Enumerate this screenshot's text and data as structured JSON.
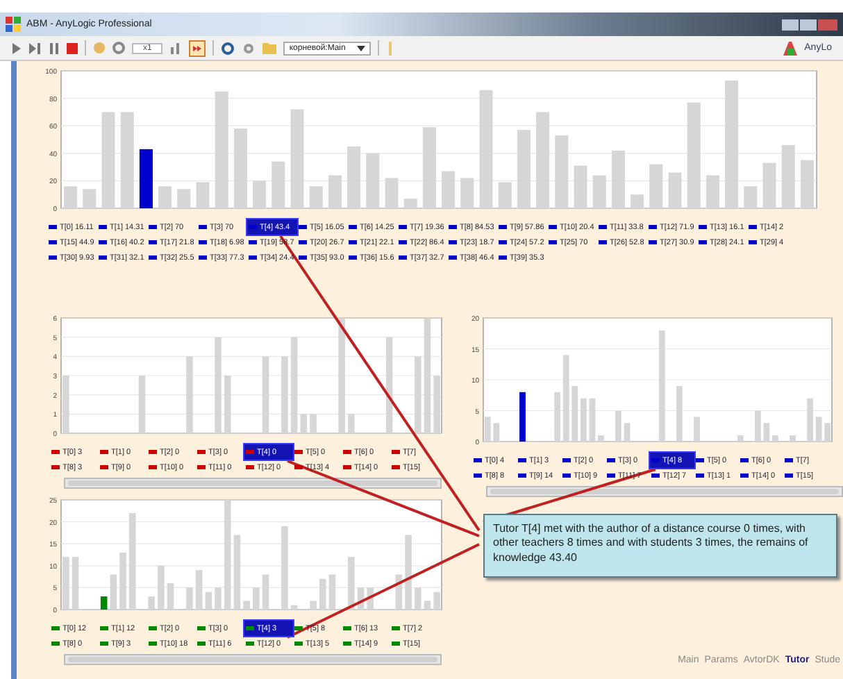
{
  "window": {
    "title": "ABM - AnyLogic Professional"
  },
  "toolbar": {
    "speed": "x1",
    "experiment": "корневой:Main",
    "brand": "AnyLo"
  },
  "charts": [
    {
      "color": "#0000cc",
      "chart_data": {
        "type": "bar",
        "grid": true,
        "values": [
          16,
          14,
          70,
          70,
          43,
          16,
          14,
          19,
          85,
          58,
          20,
          34,
          72,
          16,
          24,
          45,
          40,
          22,
          7,
          59,
          27,
          22,
          86,
          19,
          57,
          70,
          53,
          31,
          24,
          42,
          10,
          32,
          26,
          77,
          24,
          93,
          16,
          33,
          46,
          35
        ],
        "ylim": [
          0,
          100
        ],
        "yticks": [
          0,
          20,
          40,
          60,
          80,
          100
        ]
      },
      "legend": [
        {
          "label": "T[0] 16.11",
          "selected": false
        },
        {
          "label": "T[1] 14.31",
          "selected": false
        },
        {
          "label": "T[2] 70",
          "selected": false
        },
        {
          "label": "T[3] 70",
          "selected": false
        },
        {
          "label": "T[4] 43.4",
          "selected": true
        },
        {
          "label": "T[5] 16.05",
          "selected": false
        },
        {
          "label": "T[6] 14.25",
          "selected": false
        },
        {
          "label": "T[7] 19.36",
          "selected": false
        },
        {
          "label": "T[8] 84.53",
          "selected": false
        },
        {
          "label": "T[9] 57.86",
          "selected": false
        },
        {
          "label": "T[10] 20.4",
          "selected": false
        },
        {
          "label": "T[11] 33.8",
          "selected": false
        },
        {
          "label": "T[12] 71.9",
          "selected": false
        },
        {
          "label": "T[13] 16.1",
          "selected": false
        },
        {
          "label": "T[14] 2",
          "selected": false
        },
        {
          "label": "T[15] 44.9",
          "selected": false
        },
        {
          "label": "T[16] 40.2",
          "selected": false
        },
        {
          "label": "T[17] 21.8",
          "selected": false
        },
        {
          "label": "T[18] 6.98",
          "selected": false
        },
        {
          "label": "T[19] 58.7",
          "selected": false
        },
        {
          "label": "T[20] 26.7",
          "selected": false
        },
        {
          "label": "T[21] 22.1",
          "selected": false
        },
        {
          "label": "T[22] 86.4",
          "selected": false
        },
        {
          "label": "T[23] 18.7",
          "selected": false
        },
        {
          "label": "T[24] 57.2",
          "selected": false
        },
        {
          "label": "T[25] 70",
          "selected": false
        },
        {
          "label": "T[26] 52.8",
          "selected": false
        },
        {
          "label": "T[27] 30.9",
          "selected": false
        },
        {
          "label": "T[28] 24.1",
          "selected": false
        },
        {
          "label": "T[29] 4",
          "selected": false
        },
        {
          "label": "T[30] 9.93",
          "selected": false
        },
        {
          "label": "T[31] 32.1",
          "selected": false
        },
        {
          "label": "T[32] 25.5",
          "selected": false
        },
        {
          "label": "T[33] 77.3",
          "selected": false
        },
        {
          "label": "T[34] 24.4",
          "selected": false
        },
        {
          "label": "T[35] 93.0",
          "selected": false
        },
        {
          "label": "T[36] 15.6",
          "selected": false
        },
        {
          "label": "T[37] 32.7",
          "selected": false
        },
        {
          "label": "T[38] 46.4",
          "selected": false
        },
        {
          "label": "T[39] 35.3",
          "selected": false
        }
      ]
    },
    {
      "color": "#cc0000",
      "chart_data": {
        "type": "bar",
        "grid": true,
        "values": [
          3,
          0,
          0,
          0,
          0,
          0,
          0,
          0,
          3,
          0,
          0,
          0,
          0,
          4,
          0,
          0,
          5,
          3,
          0,
          0,
          0,
          4,
          0,
          4,
          5,
          1,
          1,
          0,
          0,
          6,
          1,
          0,
          0,
          0,
          5,
          0,
          0,
          4,
          6,
          3
        ],
        "ylim": [
          0,
          6
        ],
        "yticks": [
          0,
          1,
          2,
          3,
          4,
          5,
          6
        ]
      },
      "legend": [
        {
          "label": "T[0] 3",
          "selected": false
        },
        {
          "label": "T[1] 0",
          "selected": false
        },
        {
          "label": "T[2] 0",
          "selected": false
        },
        {
          "label": "T[3] 0",
          "selected": false
        },
        {
          "label": "T[4] 0",
          "selected": true
        },
        {
          "label": "T[5] 0",
          "selected": false
        },
        {
          "label": "T[6] 0",
          "selected": false
        },
        {
          "label": "T[7]",
          "selected": false
        },
        {
          "label": "T[8] 3",
          "selected": false
        },
        {
          "label": "T[9] 0",
          "selected": false
        },
        {
          "label": "T[10] 0",
          "selected": false
        },
        {
          "label": "T[11] 0",
          "selected": false
        },
        {
          "label": "T[12] 0",
          "selected": false
        },
        {
          "label": "T[13] 4",
          "selected": false
        },
        {
          "label": "T[14] 0",
          "selected": false
        },
        {
          "label": "T[15]",
          "selected": false
        }
      ]
    },
    {
      "color": "#0000cc",
      "chart_data": {
        "type": "bar",
        "grid": true,
        "values": [
          4,
          3,
          0,
          0,
          8,
          0,
          0,
          0,
          8,
          14,
          9,
          7,
          7,
          1,
          0,
          5,
          3,
          0,
          0,
          0,
          18,
          0,
          9,
          0,
          4,
          0,
          0,
          0,
          0,
          1,
          0,
          5,
          3,
          1,
          0,
          1,
          0,
          7,
          4,
          3
        ],
        "ylim": [
          0,
          20
        ],
        "yticks": [
          0,
          5,
          10,
          15,
          20
        ]
      },
      "legend": [
        {
          "label": "T[0] 4",
          "selected": false
        },
        {
          "label": "T[1] 3",
          "selected": false
        },
        {
          "label": "T[2] 0",
          "selected": false
        },
        {
          "label": "T[3] 0",
          "selected": false
        },
        {
          "label": "T[4] 8",
          "selected": true
        },
        {
          "label": "T[5] 0",
          "selected": false
        },
        {
          "label": "T[6] 0",
          "selected": false
        },
        {
          "label": "T[7]",
          "selected": false
        },
        {
          "label": "T[8] 8",
          "selected": false
        },
        {
          "label": "T[9] 14",
          "selected": false
        },
        {
          "label": "T[10] 9",
          "selected": false
        },
        {
          "label": "T[11] 7",
          "selected": false
        },
        {
          "label": "T[12] 7",
          "selected": false
        },
        {
          "label": "T[13] 1",
          "selected": false
        },
        {
          "label": "T[14] 0",
          "selected": false
        },
        {
          "label": "T[15]",
          "selected": false
        }
      ]
    },
    {
      "color": "#008800",
      "chart_data": {
        "type": "bar",
        "grid": true,
        "values": [
          12,
          12,
          0,
          0,
          3,
          8,
          13,
          22,
          0,
          3,
          10,
          6,
          0,
          5,
          9,
          4,
          5,
          25,
          17,
          2,
          5,
          8,
          0,
          19,
          1,
          0,
          2,
          7,
          8,
          0,
          12,
          5,
          5,
          0,
          0,
          8,
          17,
          5,
          2,
          4
        ],
        "ylim": [
          0,
          25
        ],
        "yticks": [
          0,
          5,
          10,
          15,
          20,
          25
        ]
      },
      "legend": [
        {
          "label": "T[0] 12",
          "selected": false
        },
        {
          "label": "T[1] 12",
          "selected": false
        },
        {
          "label": "T[2] 0",
          "selected": false
        },
        {
          "label": "T[3] 0",
          "selected": false
        },
        {
          "label": "T[4] 3",
          "selected": true
        },
        {
          "label": "T[5] 8",
          "selected": false
        },
        {
          "label": "T[6] 13",
          "selected": false
        },
        {
          "label": "T[7] 2",
          "selected": false
        },
        {
          "label": "T[8] 0",
          "selected": false
        },
        {
          "label": "T[9] 3",
          "selected": false
        },
        {
          "label": "T[10] 18",
          "selected": false
        },
        {
          "label": "T[11] 6",
          "selected": false
        },
        {
          "label": "T[12] 0",
          "selected": false
        },
        {
          "label": "T[13] 5",
          "selected": false
        },
        {
          "label": "T[14] 9",
          "selected": false
        },
        {
          "label": "T[15]",
          "selected": false
        }
      ]
    }
  ],
  "tooltip": "Tutor T[4] met with the author of a distance course 0 times, with other teachers 8 times and with students 3 times, the remains of knowledge 43.40",
  "tabs": [
    {
      "label": "Main",
      "selected": false
    },
    {
      "label": "Params",
      "selected": false
    },
    {
      "label": "AvtorDK",
      "selected": false
    },
    {
      "label": "Tutor",
      "selected": true
    },
    {
      "label": "Stude",
      "selected": false
    }
  ]
}
